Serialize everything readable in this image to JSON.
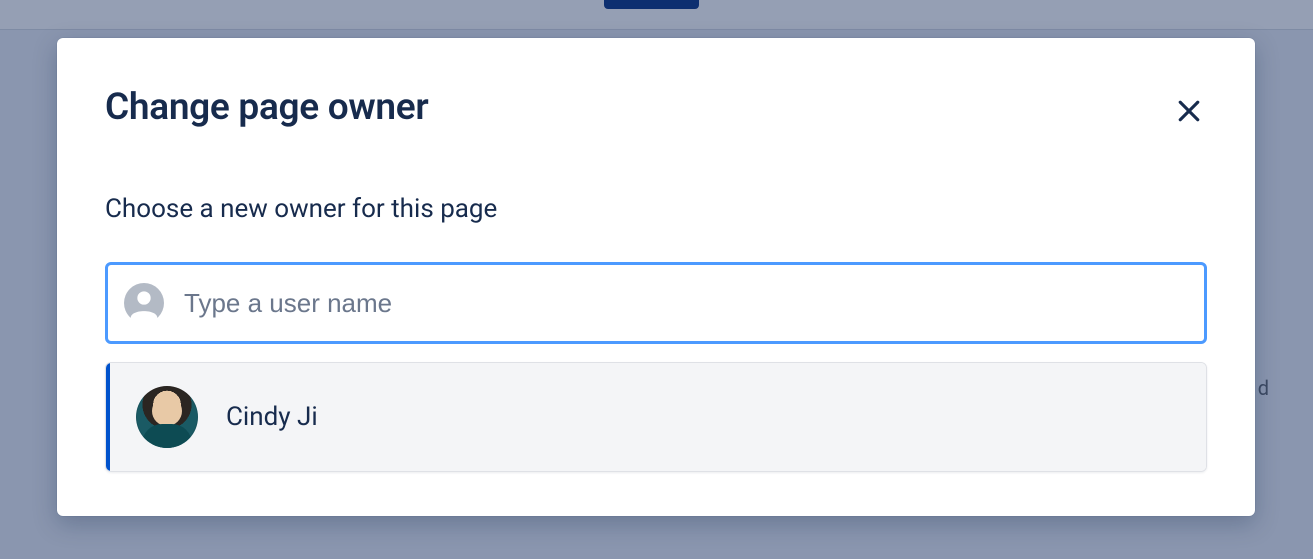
{
  "modal": {
    "title": "Change page owner",
    "subtitle": "Choose a new owner for this page",
    "input": {
      "placeholder": "Type a user name",
      "value": ""
    },
    "suggestions": [
      {
        "name": "Cindy Ji"
      }
    ]
  },
  "background": {
    "partial_text": "d"
  },
  "colors": {
    "focus_border": "#4c9aff",
    "accent": "#0052cc",
    "text": "#172b4d"
  }
}
